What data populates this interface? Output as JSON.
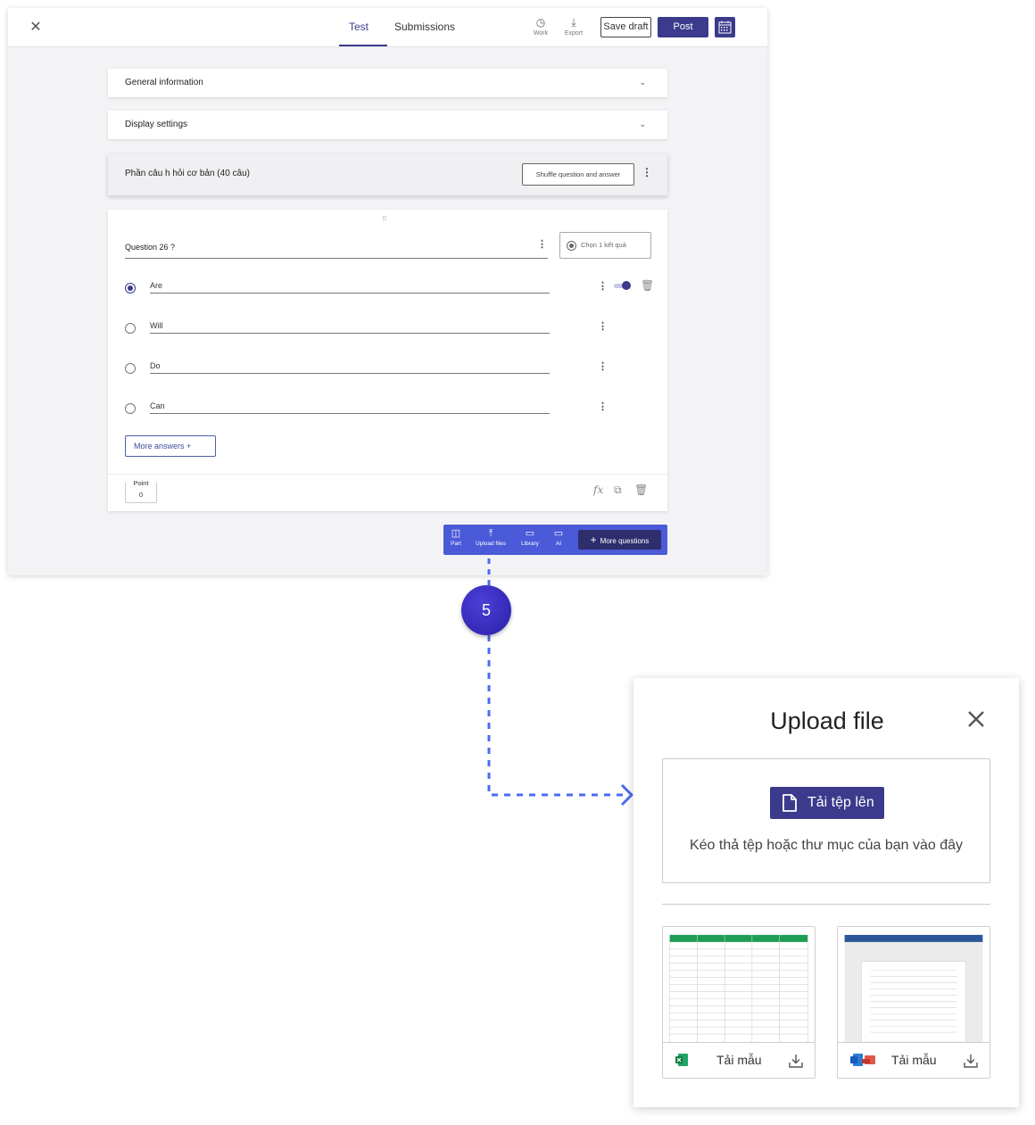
{
  "topbar": {
    "tabs": [
      "Test",
      "Submissions"
    ],
    "work_label": "Work",
    "export_label": "Export",
    "save_draft": "Save draft",
    "post": "Post"
  },
  "sections": {
    "general": "General information",
    "display": "Display settings",
    "part_title": "Phần câu h hỏi cơ bản (40 câu)",
    "shuffle": "Shuffle question and answer"
  },
  "question": {
    "title": "Question 26 ?",
    "answer_type": "Chọn 1 kết quả",
    "answers": [
      "Are",
      "Will",
      "Do",
      "Can"
    ],
    "correct_index": 0,
    "more_answers": "More answers  +",
    "point_label": "Point",
    "point_value": "0"
  },
  "toolbar": {
    "items": [
      "Part",
      "Upload files",
      "Library",
      "AI"
    ],
    "more_questions": "More questions"
  },
  "step_badge": "5",
  "modal": {
    "title": "Upload file",
    "upload_button": "Tải tệp lên",
    "drop_hint": "Kéo thả tệp hoặc thư mục của bạn vào đây",
    "templates": [
      {
        "label": "Tải mẫu",
        "kind": "excel"
      },
      {
        "label": "Tải mẫu",
        "kind": "word"
      }
    ]
  },
  "colors": {
    "primary": "#3b3a8c",
    "toolbar": "#4a5ad8",
    "badge": "#3127b8",
    "connector": "#4a6cf0"
  }
}
